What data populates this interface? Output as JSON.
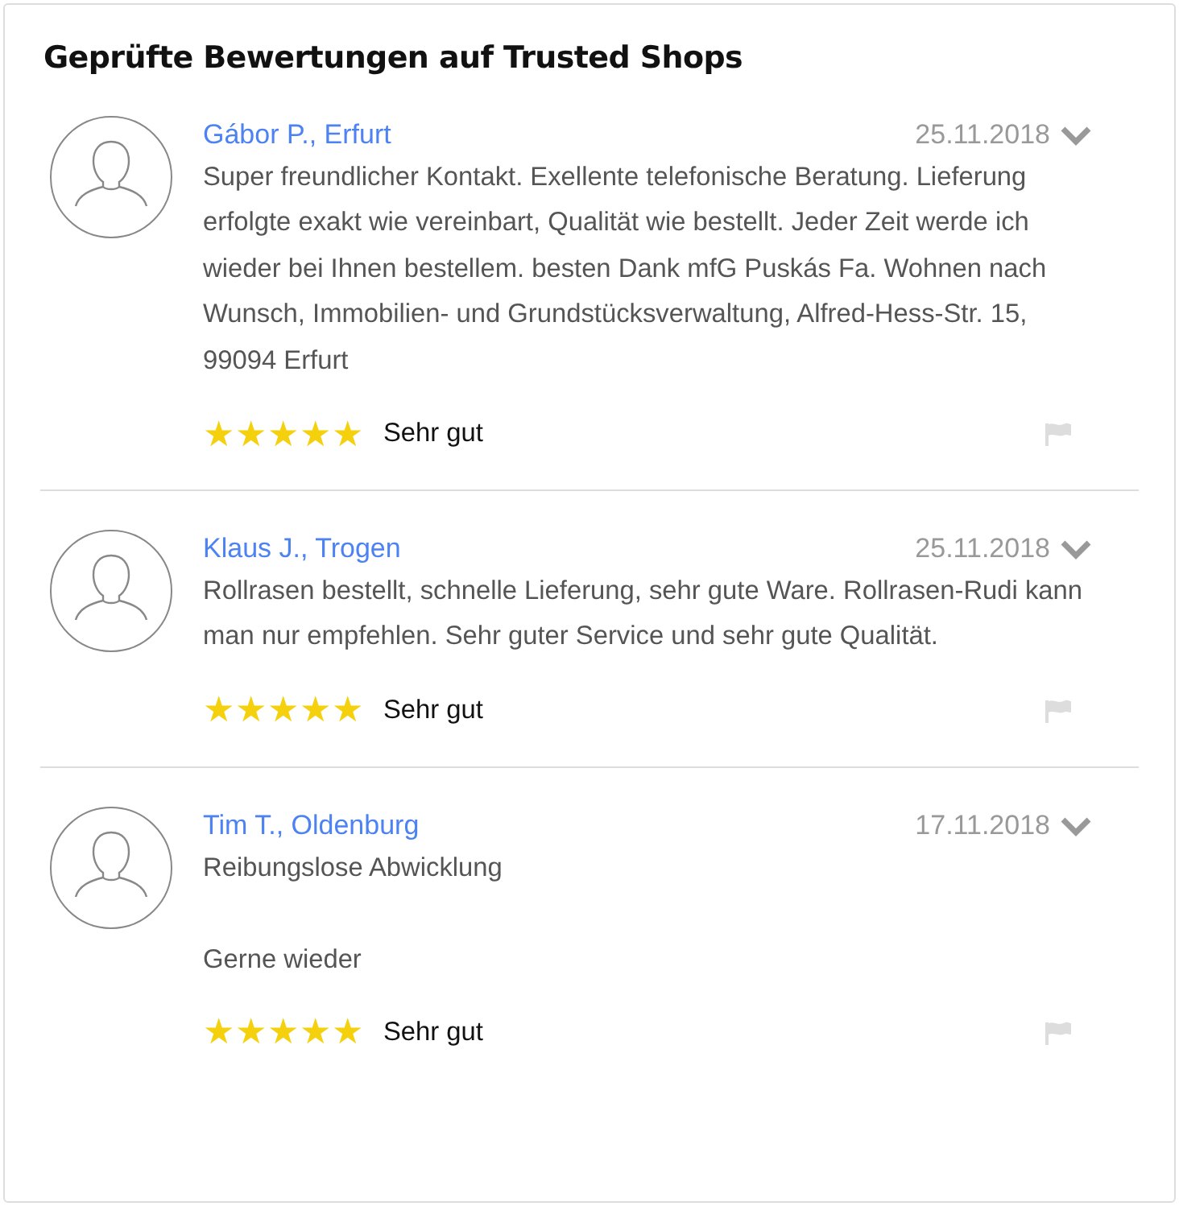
{
  "title": "Geprüfte Bewertungen auf Trusted Shops",
  "reviews": [
    {
      "author": "Gábor P., Erfurt",
      "date": "25.11.2018",
      "body": "Super freundlicher Kontakt. Exellente telefonische Beratung. Lieferung erfolgte exakt wie vereinbart, Qualität wie bestellt. Jeder Zeit werde ich wieder bei Ihnen bestellem. besten Dank mfG Puskás Fa. Wohnen nach Wunsch, Immobilien- und Grundstücksverwaltung, Alfred-Hess-Str. 15, 99094 Erfurt",
      "stars": 5,
      "rating": "Sehr gut"
    },
    {
      "author": "Klaus J., Trogen",
      "date": "25.11.2018",
      "body": "Rollrasen bestellt, schnelle Lieferung, sehr gute Ware. Rollrasen-Rudi kann man nur empfehlen. Sehr guter Service und sehr gute Qualität.",
      "stars": 5,
      "rating": "Sehr gut"
    },
    {
      "author": "Tim T., Oldenburg",
      "date": "17.11.2018",
      "body": "Reibungslose Abwicklung\n\nGerne wieder",
      "stars": 5,
      "rating": "Sehr gut"
    }
  ]
}
